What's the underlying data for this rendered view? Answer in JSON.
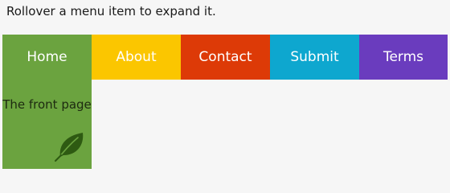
{
  "instruction": "Rollover a menu item to expand it.",
  "menu": {
    "items": [
      {
        "label": "Home",
        "color": "#6ba33f"
      },
      {
        "label": "About",
        "color": "#fbc600"
      },
      {
        "label": "Contact",
        "color": "#dd3a07"
      },
      {
        "label": "Submit",
        "color": "#0ea7cf"
      },
      {
        "label": "Terms",
        "color": "#6a3cbe"
      }
    ],
    "expanded_panel": {
      "text": "The front page",
      "icon": "leaf-icon",
      "color": "#6ba33f"
    }
  }
}
